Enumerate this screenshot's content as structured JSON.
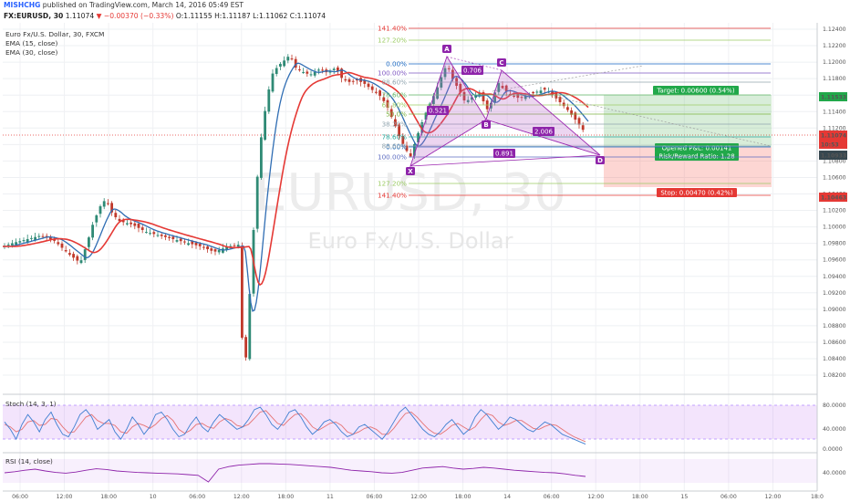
{
  "header": {
    "author": "MISHCHG",
    "published": "published on TradingView.com, March 14, 2016 05:49 EST"
  },
  "symbol_line": {
    "symbol": "FX:EURUSD, 30",
    "last": "1.11074",
    "arrow": "▼",
    "change": "−0.00370 (−0.33%)",
    "ohlc": "O:1.11155 H:1.11187 L:1.11062 C:1.11074"
  },
  "legend": {
    "title": "Euro Fx/U.S. Dollar, 30, FXCM",
    "ema15": "EMA (15, close)",
    "ema30": "EMA (30, close)"
  },
  "watermark": {
    "main": "EURUSD, 30",
    "sub": "Euro Fx/U.S. Dollar"
  },
  "price_axis": {
    "ticks": [
      "1.12400",
      "1.12200",
      "1.12000",
      "1.11800",
      "1.11600",
      "1.11400",
      "1.11200",
      "1.11000",
      "1.10800",
      "1.10600",
      "1.10400",
      "1.10200",
      "1.10000",
      "1.09800",
      "1.09600",
      "1.09400",
      "1.09200",
      "1.09000",
      "1.08800",
      "1.08600",
      "1.08400",
      "1.08200"
    ],
    "tags": [
      {
        "text": "1.11533",
        "color": "#21a84a"
      },
      {
        "text": "1.11074",
        "color": "#e53935"
      },
      {
        "text": "10:53",
        "color": "#e53935"
      },
      {
        "text": "1.10933",
        "color": "#37474f"
      },
      {
        "text": "1.10463",
        "color": "#e53935"
      }
    ]
  },
  "time_axis": {
    "ticks": [
      "06:00",
      "12:00",
      "18:00",
      "10",
      "06:00",
      "12:00",
      "18:00",
      "11",
      "06:00",
      "12:00",
      "18:00",
      "14",
      "06:00",
      "12:00",
      "18:00",
      "15",
      "06:00",
      "12:00",
      "18:0"
    ]
  },
  "harmonic": {
    "points": [
      "X",
      "A",
      "B",
      "C",
      "D"
    ],
    "ratios": [
      "0.521",
      "0.706",
      "2.006",
      "0.891"
    ],
    "fib_right": [
      "141.40%",
      "127.20%",
      "0.00%",
      "100.00%",
      "88.60%",
      "78.60%",
      "61.80%",
      "50.0%",
      "38.20%",
      "0.00%",
      "78.60%",
      "88.60%",
      "100.00%",
      "127.20%",
      "141.40%"
    ],
    "fib_left": [
      "0.00%",
      "100.00%",
      "88.60%",
      "78.60%",
      "61.80%",
      "50.0%",
      "38.20%",
      "78.60%",
      "88.60%",
      "100.00%",
      "127.20%",
      "141.40%"
    ]
  },
  "position": {
    "target": "Target: 0.00600 (0.54%)",
    "opened": "Opened P&L: 0.00141",
    "rr": "Risk/Reward Ratio: 1.28",
    "stop": "Stop: 0.00470 (0.42%)"
  },
  "stoch": {
    "label": "Stoch (14, 3, 1)",
    "ticks": [
      "80.0000",
      "40.0000",
      "0.0000"
    ],
    "k": [
      55,
      40,
      20,
      50,
      70,
      55,
      35,
      60,
      75,
      50,
      30,
      25,
      45,
      70,
      80,
      65,
      40,
      50,
      60,
      35,
      20,
      40,
      65,
      50,
      30,
      45,
      70,
      75,
      60,
      40,
      25,
      30,
      50,
      65,
      45,
      35,
      55,
      70,
      60,
      50,
      40,
      45,
      60,
      80,
      85,
      70,
      50,
      40,
      55,
      75,
      80,
      65,
      45,
      30,
      40,
      55,
      60,
      50,
      35,
      25,
      30,
      45,
      50,
      40,
      30,
      20,
      35,
      55,
      75,
      85,
      70,
      55,
      40,
      30,
      25,
      35,
      50,
      60,
      45,
      30,
      40,
      65,
      80,
      70,
      55,
      40,
      50,
      65,
      60,
      50,
      40,
      35,
      45,
      55,
      50,
      40,
      30,
      25,
      20,
      15,
      10
    ],
    "d": [
      50,
      45,
      35,
      40,
      55,
      58,
      48,
      50,
      62,
      60,
      45,
      33,
      35,
      50,
      65,
      70,
      58,
      52,
      52,
      48,
      35,
      32,
      45,
      52,
      48,
      42,
      50,
      62,
      68,
      58,
      40,
      32,
      38,
      50,
      52,
      45,
      42,
      55,
      62,
      58,
      48,
      45,
      50,
      62,
      75,
      78,
      65,
      52,
      48,
      60,
      70,
      72,
      60,
      45,
      38,
      45,
      52,
      55,
      48,
      35,
      30,
      35,
      42,
      45,
      40,
      30,
      30,
      42,
      58,
      72,
      75,
      65,
      52,
      40,
      32,
      30,
      38,
      48,
      52,
      45,
      38,
      45,
      60,
      72,
      68,
      55,
      48,
      52,
      58,
      58,
      50,
      42,
      40,
      46,
      50,
      48,
      40,
      32,
      25,
      20,
      15
    ]
  },
  "rsi": {
    "label": "RSI (14, close)",
    "ticks": [
      "40.0000"
    ],
    "values": [
      45,
      48,
      52,
      55,
      50,
      46,
      44,
      47,
      52,
      56,
      54,
      50,
      48,
      46,
      45,
      44,
      43,
      42,
      40,
      38,
      20,
      55,
      62,
      66,
      68,
      70,
      70,
      69,
      68,
      66,
      64,
      62,
      60,
      56,
      52,
      50,
      48,
      45,
      44,
      46,
      52,
      58,
      60,
      62,
      58,
      55,
      57,
      60,
      58,
      55,
      52,
      50,
      48,
      46,
      45,
      42,
      38,
      35
    ]
  },
  "colors": {
    "up": "#2f8a75",
    "down": "#c0392b",
    "ema15": "#2f6db3",
    "ema30": "#e53935",
    "harmonic": "#9c27b0",
    "stoch_k": "#3f7fd1",
    "stoch_d": "#e57373",
    "rsi": "#8e24aa"
  }
}
